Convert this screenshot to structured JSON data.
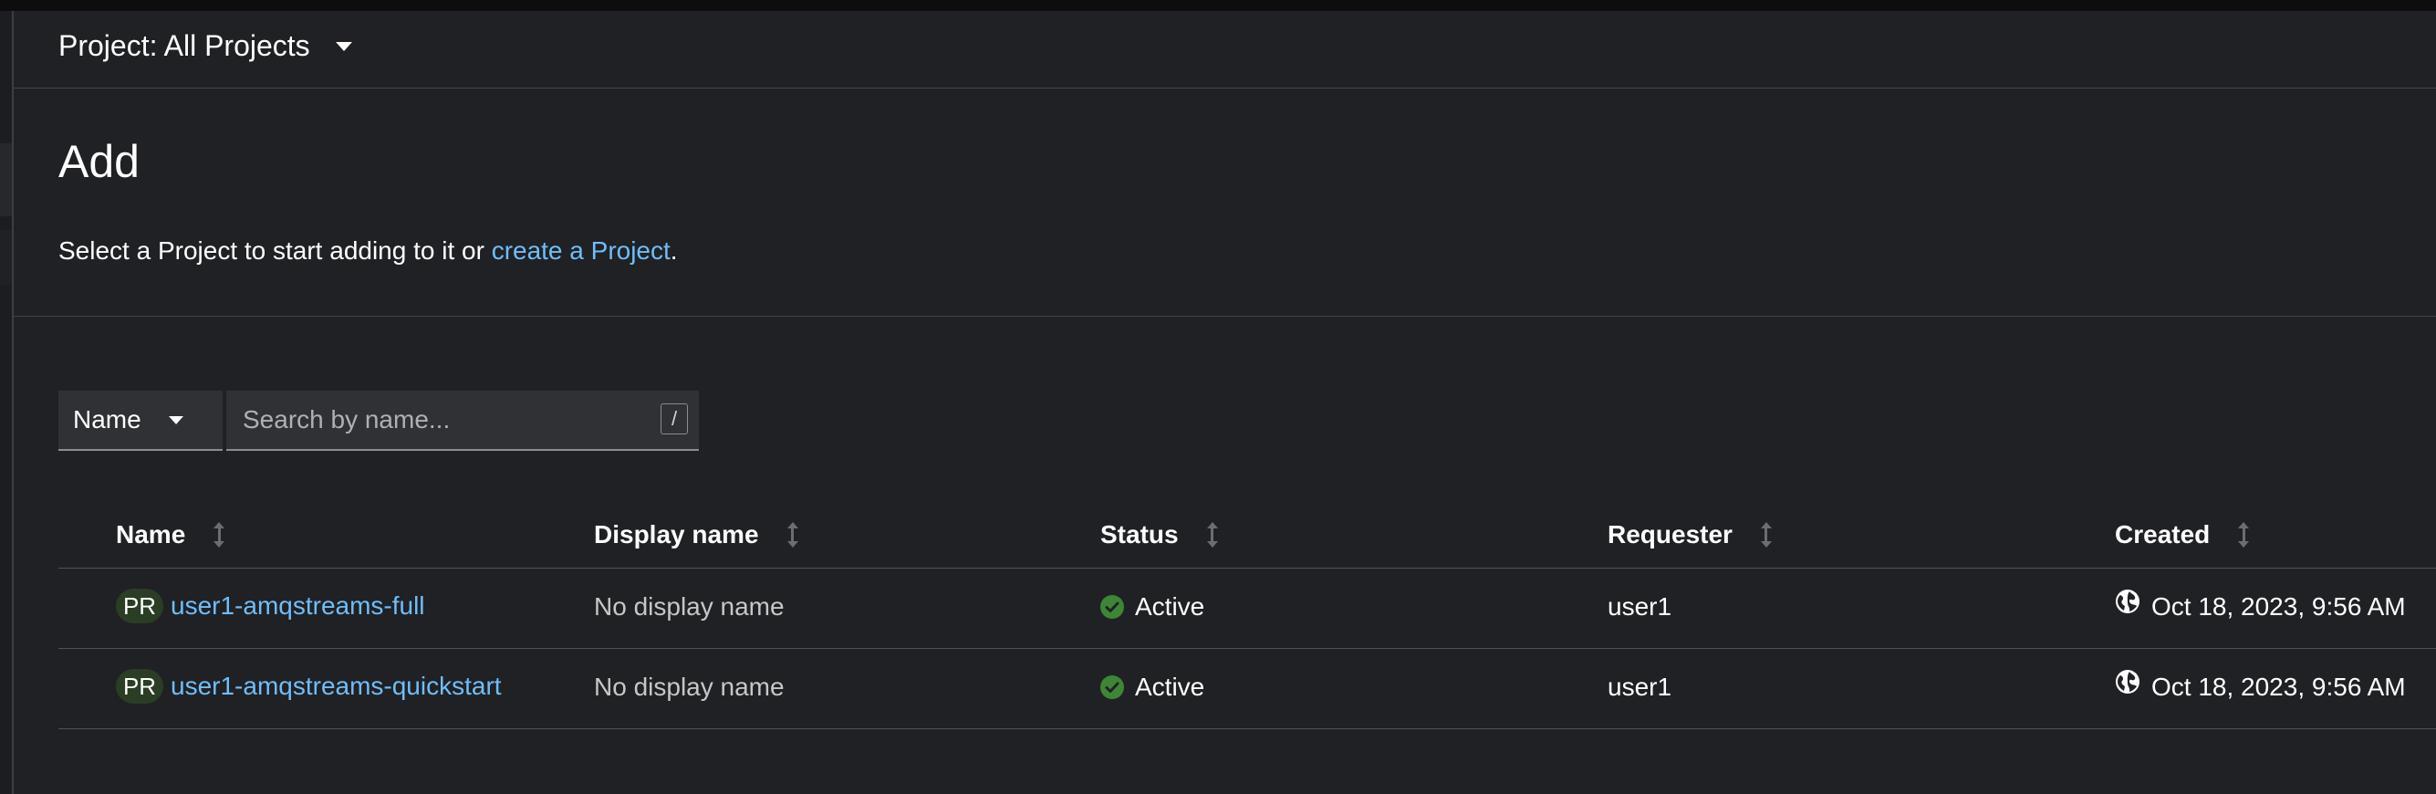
{
  "project_bar": {
    "selector_label": "Project: All Projects"
  },
  "page": {
    "title": "Add",
    "intro_prefix": "Select a Project to start adding to it or ",
    "intro_link": "create a Project",
    "intro_suffix": "."
  },
  "toolbar": {
    "filter_label": "Name",
    "search_placeholder": "Search by name...",
    "shortcut_hint": "/"
  },
  "table": {
    "columns": [
      "Name",
      "Display name",
      "Status",
      "Requester",
      "Created"
    ],
    "rows": [
      {
        "badge": "PR",
        "name": "user1-amqstreams-full",
        "display_name": "No display name",
        "status": "Active",
        "requester": "user1",
        "created": "Oct 18, 2023, 9:56 AM"
      },
      {
        "badge": "PR",
        "name": "user1-amqstreams-quickstart",
        "display_name": "No display name",
        "status": "Active",
        "requester": "user1",
        "created": "Oct 18, 2023, 9:56 AM"
      }
    ]
  },
  "icons": {
    "project_dropdown": "caret-down-icon",
    "filter_dropdown": "caret-down-icon",
    "sort": "sort-icon",
    "status_active": "check-circle-icon",
    "created": "globe-icon"
  },
  "colors": {
    "link": "#73bcf7",
    "status_active": "#3e8635",
    "badge_bg": "#2b3d25",
    "background": "#1f2125"
  }
}
